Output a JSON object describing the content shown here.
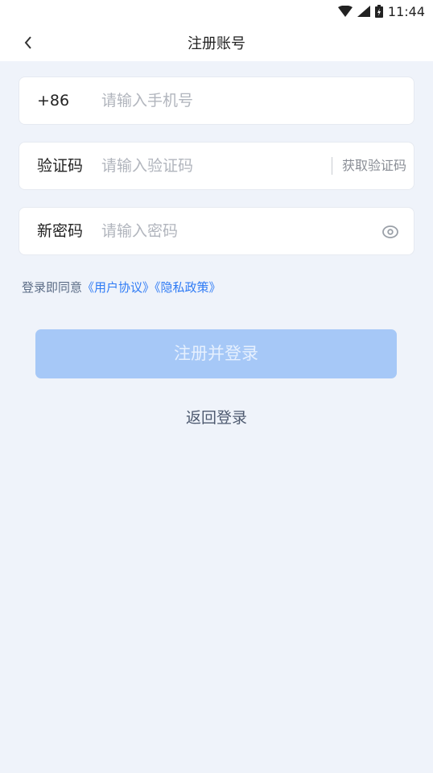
{
  "status": {
    "time": "11:44"
  },
  "header": {
    "title": "注册账号"
  },
  "phone": {
    "prefix": "+86",
    "placeholder": "请输入手机号"
  },
  "code": {
    "label": "验证码",
    "placeholder": "请输入验证码",
    "get_code": "获取验证码"
  },
  "password": {
    "label": "新密码",
    "placeholder": "请输入密码"
  },
  "agreement": {
    "prefix": "登录即同意",
    "user_agreement": "《用户协议》",
    "privacy_policy": "《隐私政策》"
  },
  "actions": {
    "register": "注册并登录",
    "back_to_login": "返回登录"
  },
  "colors": {
    "accent": "#2f7bf5",
    "button_disabled": "#a6c8f7",
    "background": "#eff3fa"
  }
}
